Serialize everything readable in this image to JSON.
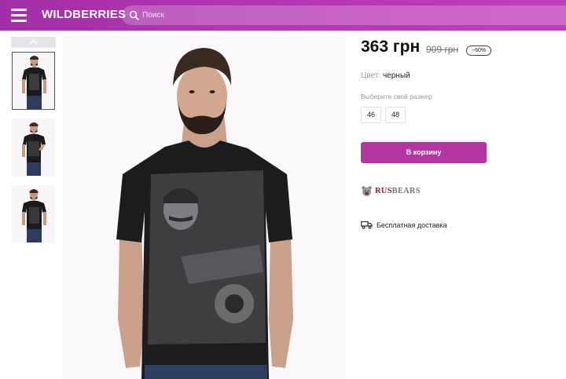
{
  "header": {
    "logo": "WILDBERRIES",
    "search_placeholder": "Поиск",
    "menu_icon": "hamburger-menu-icon",
    "search_icon": "magnifier-icon",
    "gradient_colors": [
      "#a32fa8",
      "#c13fbd"
    ]
  },
  "gallery": {
    "scroll_icon": "chevron-up-icon",
    "thumbnails": 3,
    "active_thumbnail": 1
  },
  "product": {
    "price": "363 грн",
    "old_price": "909 грн",
    "discount": "−60%",
    "color_label": "Цвет:",
    "color_value": "черный",
    "size_label": "Выберите свой размер",
    "sizes": [
      "46",
      "48"
    ],
    "cart_button": "В корзину",
    "cart_color": "#b3359f",
    "brand": {
      "part1": "RUS",
      "part2": "BEARS",
      "icon": "bear-logo-icon"
    },
    "delivery": {
      "icon": "truck-icon",
      "text": "Бесплатная доставка"
    }
  }
}
